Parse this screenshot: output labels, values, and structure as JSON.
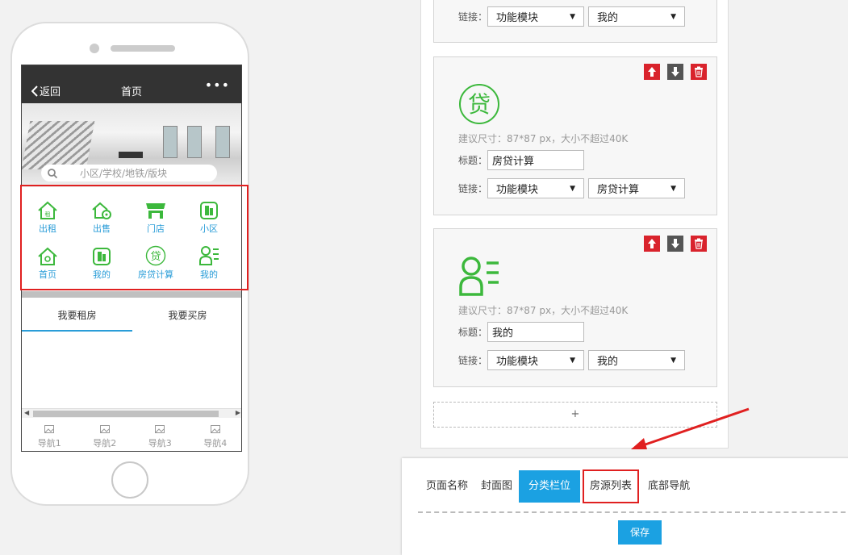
{
  "phone": {
    "topbar": {
      "back": "返回",
      "title": "首页",
      "more": "•••"
    },
    "search_placeholder": "小区/学校/地铁/版块",
    "grid": [
      {
        "label": "出租",
        "icon": "house-rent-icon"
      },
      {
        "label": "出售",
        "icon": "house-sale-icon"
      },
      {
        "label": "门店",
        "icon": "store-icon"
      },
      {
        "label": "小区",
        "icon": "building-icon"
      },
      {
        "label": "首页",
        "icon": "home-icon"
      },
      {
        "label": "我的",
        "icon": "building-icon"
      },
      {
        "label": "房贷计算",
        "icon": "loan-icon"
      },
      {
        "label": "我的",
        "icon": "user-list-icon"
      }
    ],
    "tabs": [
      "我要租房",
      "我要买房"
    ],
    "bottom_nav": [
      "导航1",
      "导航2",
      "导航3",
      "导航4"
    ]
  },
  "panel": {
    "top_card": {
      "link_label": "链接：",
      "link_type": "功能模块",
      "link_target": "我的"
    },
    "cards": [
      {
        "icon_text": "贷",
        "hint": "建议尺寸：87*87 px，大小不超过40K",
        "title_label": "标题：",
        "title_value": "房贷计算",
        "link_label": "链接：",
        "link_type": "功能模块",
        "link_target": "房贷计算"
      },
      {
        "icon_text": "",
        "hint": "建议尺寸：87*87 px，大小不超过40K",
        "title_label": "标题：",
        "title_value": "我的",
        "link_label": "链接：",
        "link_type": "功能模块",
        "link_target": "我的"
      }
    ],
    "add_label": "+"
  },
  "bottom_panel": {
    "tabs": [
      "页面名称",
      "封面图",
      "分类栏位",
      "房源列表",
      "底部导航"
    ],
    "active_tab": "分类栏位",
    "save_label": "保存"
  },
  "colors": {
    "accent": "#1ba1e2",
    "icon_green": "#3cb83c",
    "danger": "#d9232c"
  }
}
